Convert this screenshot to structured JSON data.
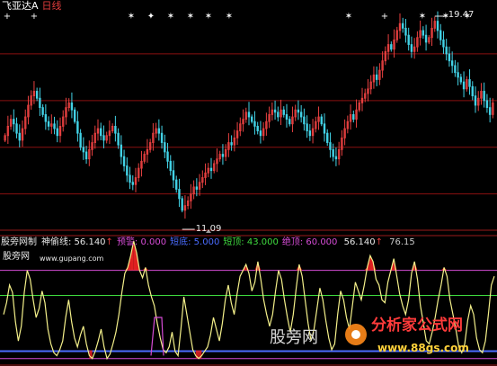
{
  "title": {
    "stock": "飞亚达A",
    "period": "日线"
  },
  "price_labels": {
    "high": "19.47",
    "low": "11.09"
  },
  "indicator": {
    "panel_name": "股旁网制",
    "items": [
      {
        "label": "神偷线:",
        "value": "56.140",
        "arrow": "↑",
        "color": "#e8e8e8"
      },
      {
        "label": "预警:",
        "value": "0.000",
        "arrow": "",
        "color": "#d64cd6"
      },
      {
        "label": "短底:",
        "value": "5.000",
        "arrow": "",
        "color": "#4a6cff"
      },
      {
        "label": "短顶:",
        "value": "43.000",
        "arrow": "",
        "color": "#3fdc3f"
      },
      {
        "label": "绝顶:",
        "value": "60.000",
        "arrow": "",
        "color": "#d64cd6"
      },
      {
        "label": "",
        "value": "56.140",
        "arrow": "↑",
        "color": "#e8e8e8"
      },
      {
        "label": "",
        "value": "76.15",
        "arrow": "",
        "color": "#c8c8c8"
      }
    ]
  },
  "site": {
    "name": "股旁网",
    "url": "www.gupang.com"
  },
  "watermark": "股旁网",
  "brand": {
    "name": "分析家公式网",
    "url": "www.88gs.com"
  },
  "colors": {
    "up": "#e84040",
    "down": "#42d2e6",
    "grid": "#8a1010",
    "signal": "#ffffff"
  },
  "chart_data": [
    {
      "type": "candlestick",
      "title": "飞亚达A 日线",
      "annotations": [
        {
          "label": "19.47",
          "kind": "high"
        },
        {
          "label": "11.09",
          "kind": "low"
        }
      ],
      "ylim": [
        10.6,
        20.0
      ],
      "close": [
        14.5,
        14.9,
        15.2,
        15.0,
        14.6,
        14.3,
        14.8,
        15.3,
        15.8,
        16.2,
        16.4,
        16.1,
        15.7,
        15.4,
        15.1,
        14.9,
        15.0,
        14.8,
        14.5,
        14.9,
        15.3,
        15.7,
        15.9,
        15.6,
        15.1,
        14.6,
        14.0,
        13.8,
        13.5,
        13.9,
        14.2,
        14.6,
        14.8,
        14.5,
        14.3,
        14.5,
        14.7,
        14.9,
        14.6,
        14.1,
        13.6,
        13.2,
        12.8,
        12.5,
        12.4,
        12.7,
        13.1,
        13.4,
        13.7,
        13.9,
        14.2,
        14.6,
        14.8,
        14.6,
        14.2,
        13.8,
        13.4,
        13.0,
        12.6,
        12.2,
        11.8,
        11.3,
        11.5,
        11.7,
        12.0,
        12.3,
        12.2,
        12.5,
        12.7,
        12.9,
        13.1,
        13.0,
        13.3,
        13.5,
        13.7,
        13.6,
        13.9,
        14.2,
        14.1,
        14.4,
        14.7,
        15.0,
        15.2,
        15.5,
        15.3,
        15.1,
        14.9,
        14.7,
        14.5,
        14.8,
        15.1,
        15.4,
        15.6,
        15.5,
        15.3,
        15.6,
        15.4,
        15.2,
        15.0,
        15.3,
        15.6,
        15.5,
        15.3,
        15.0,
        14.7,
        14.5,
        14.8,
        15.1,
        15.3,
        15.0,
        14.6,
        14.2,
        13.9,
        13.6,
        13.5,
        13.9,
        14.4,
        14.8,
        15.1,
        15.4,
        15.2,
        15.6,
        15.9,
        16.1,
        16.3,
        16.5,
        16.8,
        17.1,
        16.9,
        17.3,
        17.7,
        18.1,
        18.4,
        18.2,
        18.6,
        19.0,
        19.3,
        19.1,
        18.8,
        18.4,
        18.1,
        18.3,
        18.7,
        19.0,
        18.8,
        18.5,
        18.7,
        19.1,
        19.4,
        19.0,
        18.6,
        18.3,
        18.0,
        17.7,
        17.5,
        17.2,
        17.0,
        16.8,
        16.5,
        16.9,
        16.6,
        16.2,
        15.8,
        16.1,
        16.4,
        16.0,
        15.7,
        15.4,
        15.9
      ]
    },
    {
      "type": "line",
      "title": "股旁网制",
      "ylim": [
        -2,
        80
      ],
      "reference_lines": [
        {
          "name": "预警",
          "value": 0,
          "color": "#d64cd6"
        },
        {
          "name": "短底",
          "value": 5,
          "color": "#4a6cff"
        },
        {
          "name": "短顶",
          "value": 43,
          "color": "#3fdc3f"
        },
        {
          "name": "绝顶",
          "value": 60,
          "color": "#d64cd6"
        }
      ],
      "series": [
        {
          "name": "神偷线",
          "values": [
            30,
            38,
            50,
            45,
            25,
            12,
            22,
            45,
            60,
            54,
            40,
            28,
            34,
            46,
            38,
            20,
            10,
            4,
            2,
            6,
            12,
            28,
            40,
            25,
            14,
            8,
            16,
            22,
            10,
            2,
            0,
            5,
            12,
            20,
            8,
            0,
            3,
            10,
            18,
            30,
            45,
            58,
            62,
            70,
            80,
            72,
            60,
            55,
            62,
            50,
            42,
            36,
            24,
            14,
            6,
            4,
            8,
            18,
            5,
            2,
            20,
            42,
            30,
            18,
            6,
            2,
            0,
            2,
            5,
            8,
            16,
            28,
            20,
            12,
            24,
            40,
            50,
            38,
            30,
            44,
            56,
            60,
            64,
            58,
            46,
            52,
            66,
            54,
            40,
            30,
            22,
            30,
            46,
            60,
            54,
            40,
            28,
            18,
            30,
            48,
            64,
            56,
            40,
            24,
            12,
            20,
            34,
            48,
            40,
            26,
            14,
            6,
            10,
            30,
            46,
            40,
            28,
            20,
            36,
            52,
            46,
            40,
            50,
            62,
            70,
            66,
            54,
            50,
            40,
            38,
            52,
            60,
            68,
            56,
            44,
            36,
            30,
            40,
            58,
            66,
            54,
            36,
            24,
            12,
            10,
            18,
            28,
            40,
            50,
            62,
            56,
            40,
            30,
            20,
            8,
            4,
            10,
            26,
            36,
            30,
            14,
            6,
            4,
            12,
            30,
            50,
            56
          ]
        }
      ]
    }
  ]
}
